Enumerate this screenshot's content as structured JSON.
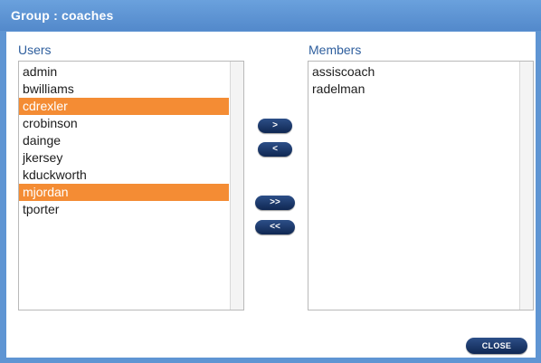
{
  "dialog": {
    "title": "Group : coaches"
  },
  "users": {
    "label": "Users",
    "items": [
      {
        "name": "admin",
        "selected": false
      },
      {
        "name": "bwilliams",
        "selected": false
      },
      {
        "name": "cdrexler",
        "selected": true
      },
      {
        "name": "crobinson",
        "selected": false
      },
      {
        "name": "dainge",
        "selected": false
      },
      {
        "name": "jkersey",
        "selected": false
      },
      {
        "name": "kduckworth",
        "selected": false
      },
      {
        "name": "mjordan",
        "selected": true
      },
      {
        "name": "tporter",
        "selected": false
      }
    ]
  },
  "members": {
    "label": "Members",
    "items": [
      {
        "name": "assiscoach",
        "selected": false
      },
      {
        "name": "radelman",
        "selected": false
      }
    ]
  },
  "buttons": {
    "add": ">",
    "remove": "<",
    "add_all": ">>",
    "remove_all": "<<",
    "close": "CLOSE"
  },
  "colors": {
    "title_bar": "#5f95d3",
    "selection": "#f48c34",
    "button": "#1b3564",
    "label_text": "#2f5f9e"
  }
}
